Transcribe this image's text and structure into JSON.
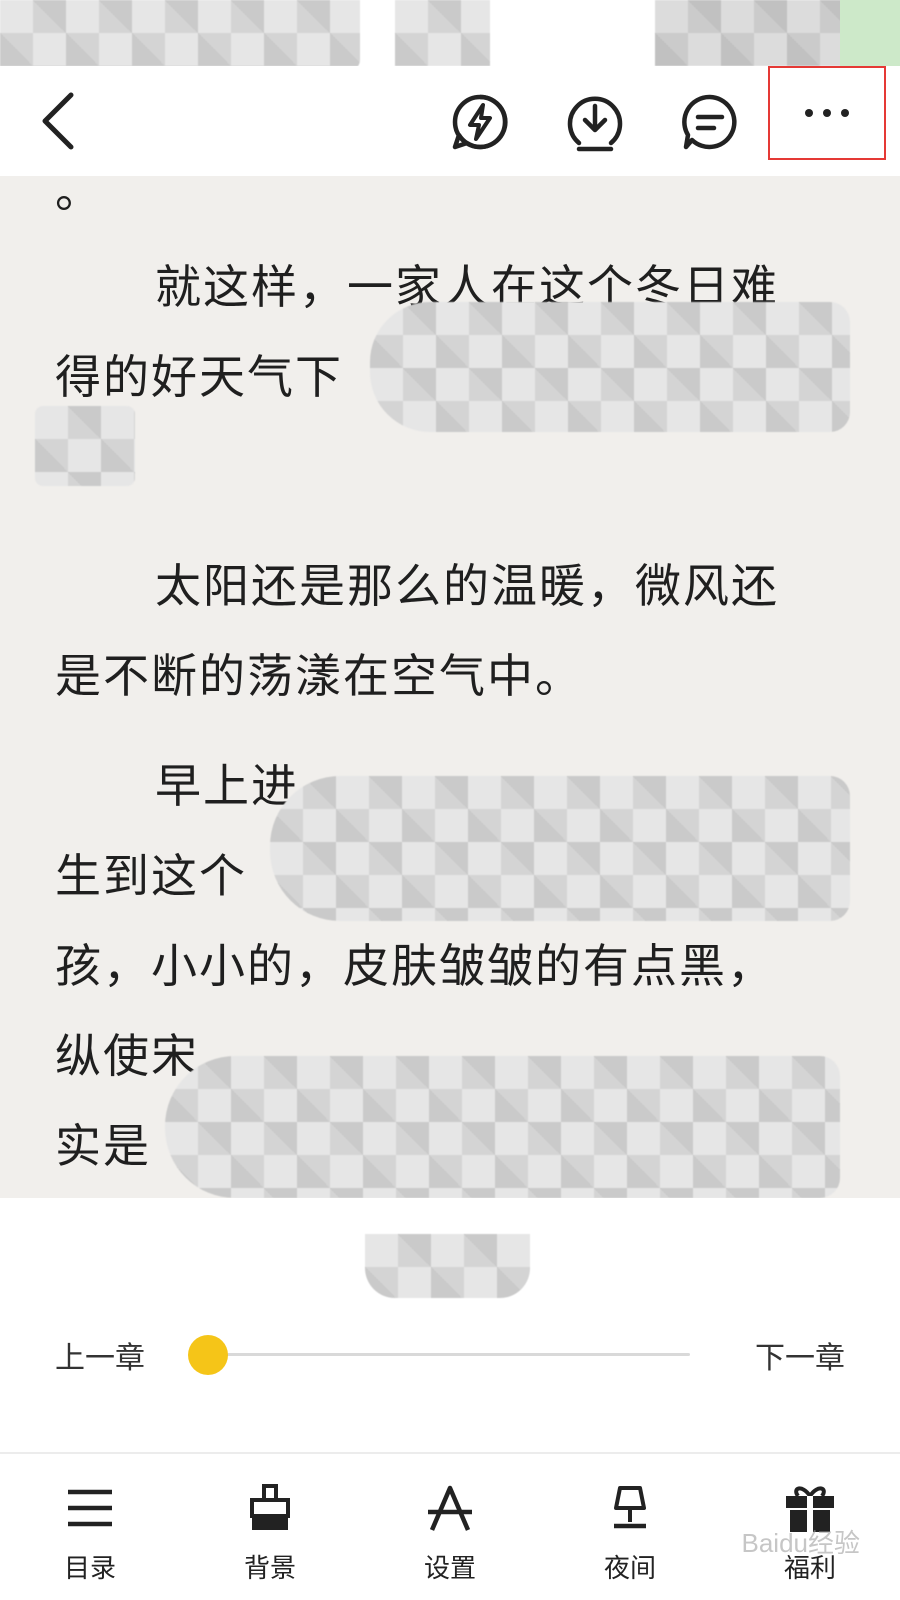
{
  "nav": {
    "back_icon": "chevron-left-icon",
    "actions": [
      "flash-icon",
      "download-icon",
      "comment-icon",
      "more-icon"
    ],
    "highlight_color": "#e53935"
  },
  "reading": {
    "leading_mark": "。",
    "paragraphs": [
      {
        "line1": "就这样，一家人在这个冬日难",
        "line2": "得的好天气下"
      },
      {
        "line1": "太阳还是那么的温暖，微风还",
        "line2": "是不断的荡漾在空气中。"
      },
      {
        "line1": "早上进",
        "line2": "生到这个",
        "line3": "孩，小小的，皮肤皱皱的有点黑，",
        "line4": "纵使宋",
        "line5": "实是"
      }
    ],
    "background": "#f1efec"
  },
  "chapter": {
    "prev_label": "上一章",
    "next_label": "下一章",
    "progress": 0.0,
    "accent": "#f5c518"
  },
  "toolbar": {
    "items": [
      {
        "label": "目录",
        "icon": "menu-icon"
      },
      {
        "label": "背景",
        "icon": "paint-bucket-icon"
      },
      {
        "label": "设置",
        "icon": "font-settings-icon"
      },
      {
        "label": "夜间",
        "icon": "lamp-icon"
      },
      {
        "label": "福利",
        "icon": "gift-icon"
      }
    ]
  },
  "watermark": "Baidu经验"
}
